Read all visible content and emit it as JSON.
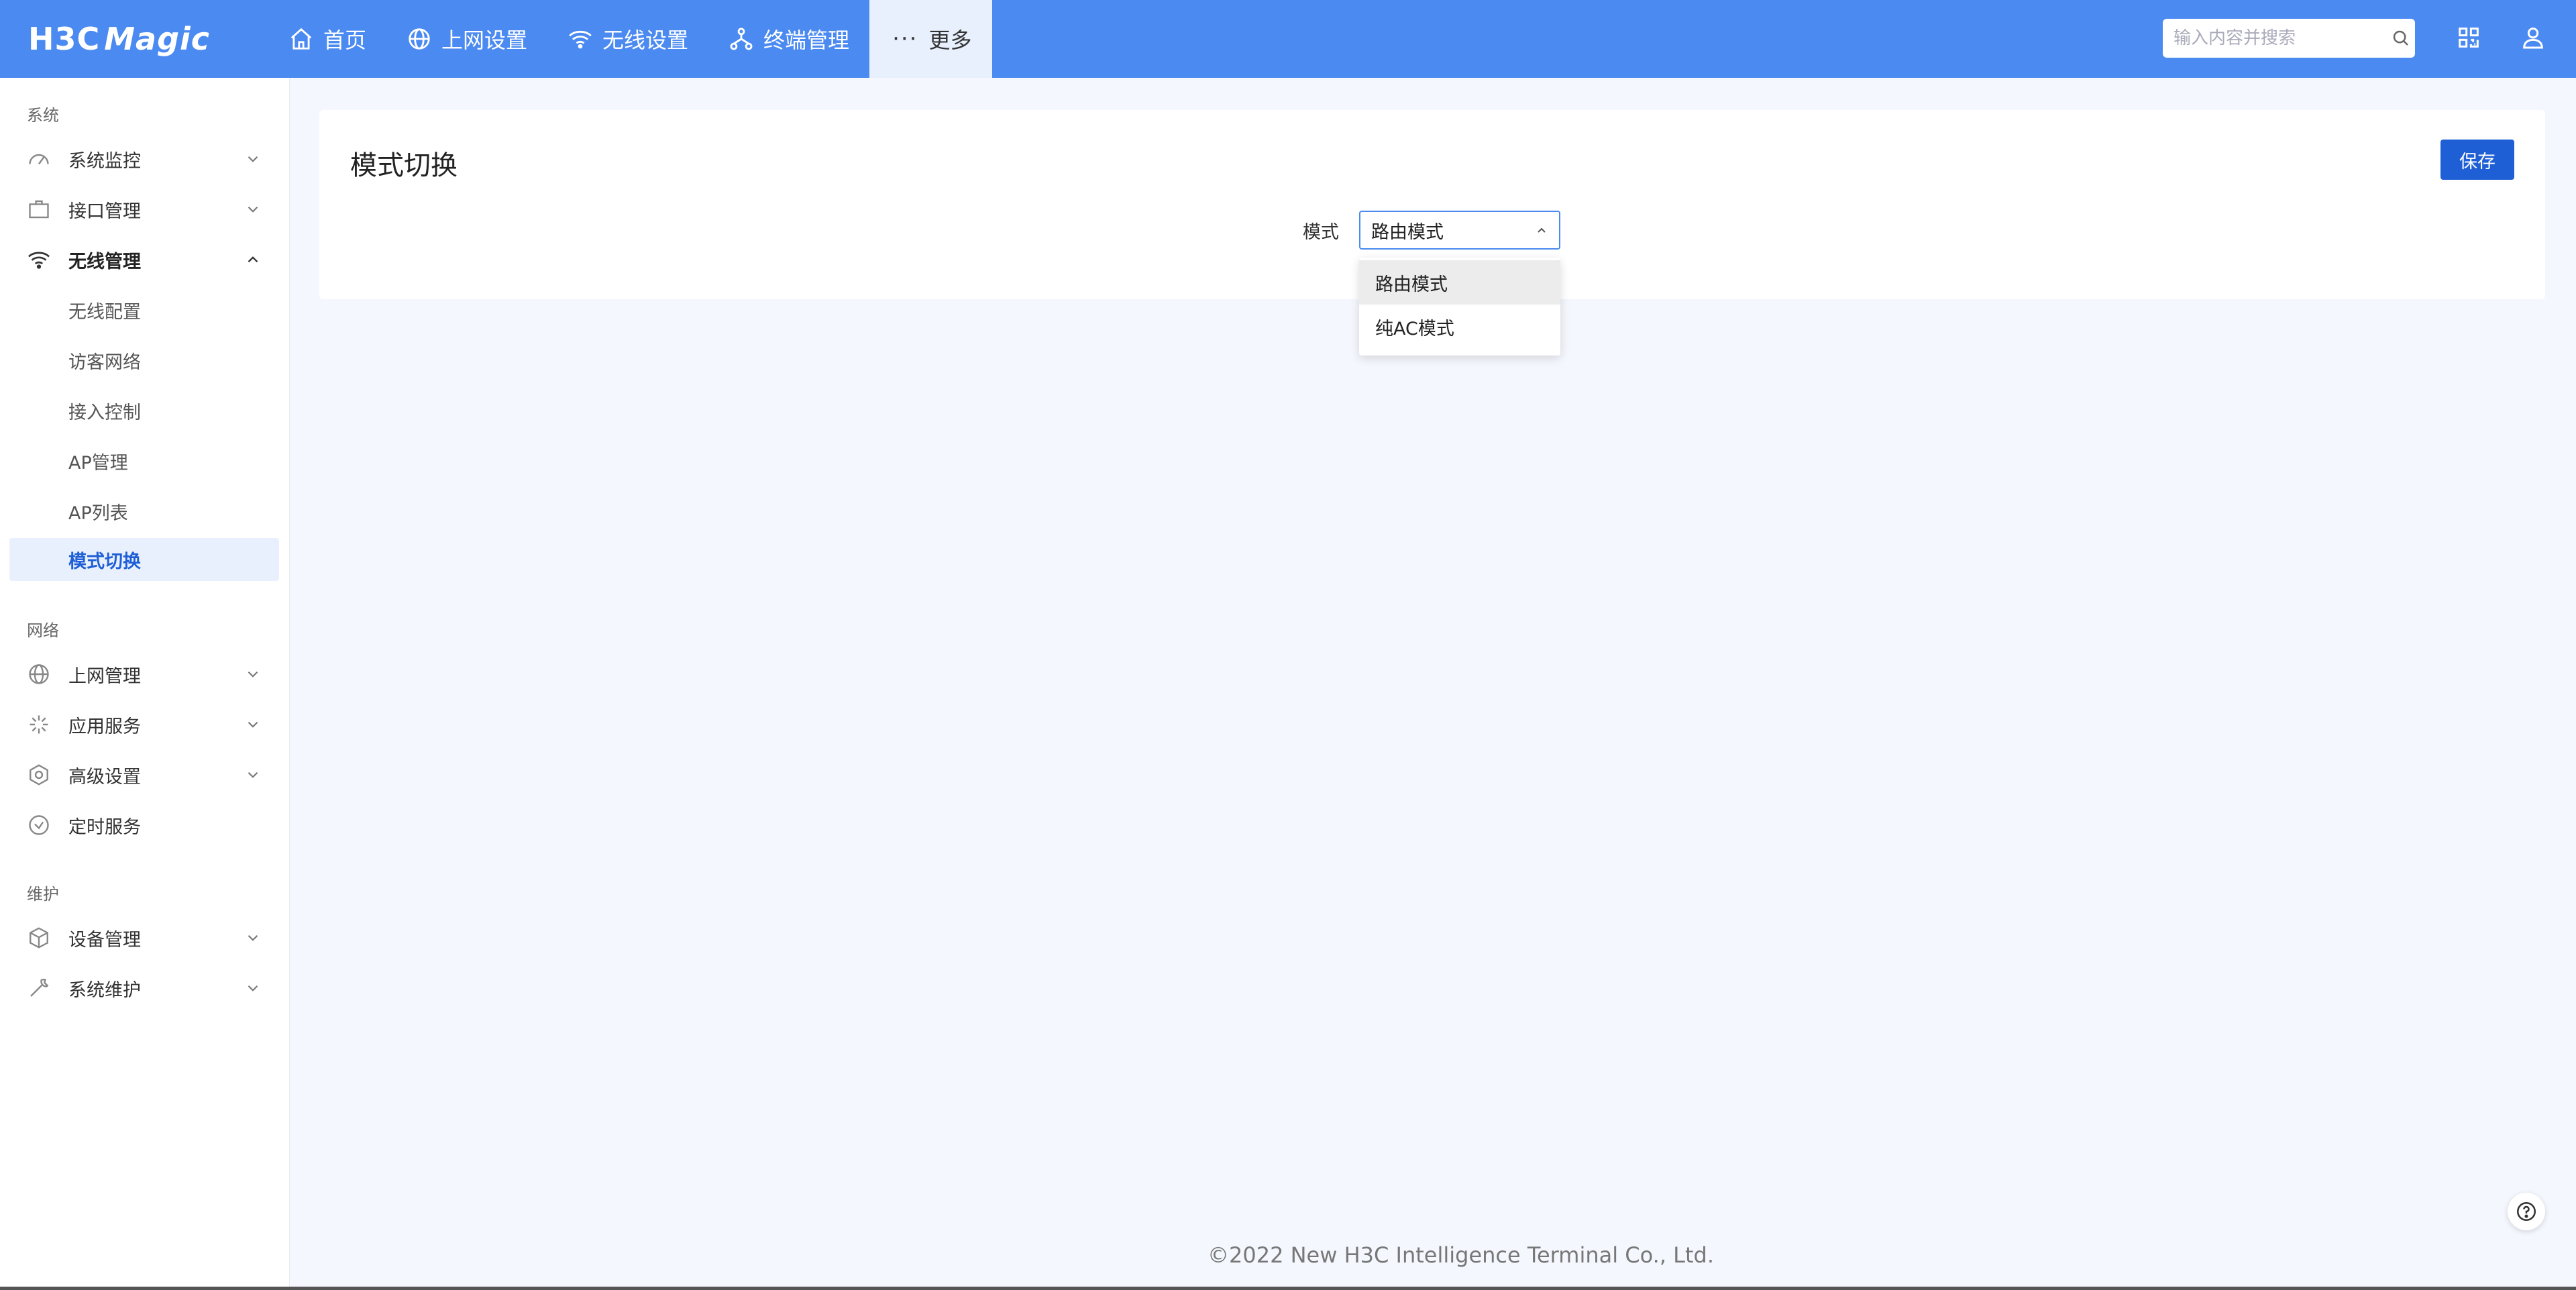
{
  "header": {
    "logo": "H3C",
    "logo_magic": "Magic",
    "nav": [
      {
        "label": "首页",
        "icon": "home-icon"
      },
      {
        "label": "上网设置",
        "icon": "globe-icon"
      },
      {
        "label": "无线设置",
        "icon": "wifi-icon"
      },
      {
        "label": "终端管理",
        "icon": "network-icon"
      },
      {
        "label": "更多",
        "icon": "more-icon"
      }
    ],
    "search_placeholder": "输入内容并搜索",
    "accent_color": "#4b8af0"
  },
  "sidebar": {
    "sections": [
      "系统",
      "网络",
      "维护"
    ],
    "system_items": [
      {
        "label": "系统监控",
        "icon": "gauge-icon"
      },
      {
        "label": "接口管理",
        "icon": "briefcase-icon"
      },
      {
        "label": "无线管理",
        "icon": "wifi-icon"
      }
    ],
    "wireless_subitems": [
      "无线配置",
      "访客网络",
      "接入控制",
      "AP管理",
      "AP列表",
      "模式切换"
    ],
    "network_items": [
      {
        "label": "上网管理",
        "icon": "globe-icon"
      },
      {
        "label": "应用服务",
        "icon": "burst-icon"
      },
      {
        "label": "高级设置",
        "icon": "hexagon-gear-icon"
      },
      {
        "label": "定时服务",
        "icon": "clock-icon"
      }
    ],
    "maintenance_items": [
      {
        "label": "设备管理",
        "icon": "cube-icon"
      },
      {
        "label": "系统维护",
        "icon": "wrench-icon"
      }
    ]
  },
  "main": {
    "title": "模式切换",
    "save_label": "保存",
    "field_label": "模式",
    "selected_value": "路由模式",
    "options": [
      "路由模式",
      "纯AC模式"
    ],
    "active_color": "#1f5fd6"
  },
  "footer": {
    "copyright": "©2022 New H3C Intelligence Terminal Co., Ltd."
  }
}
